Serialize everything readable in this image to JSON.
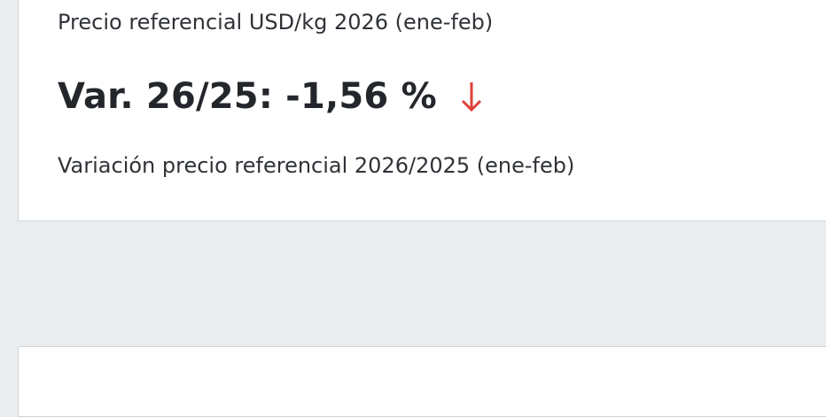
{
  "price_card": {
    "caption": "Precio referencial USD/kg 2026 (ene-feb)",
    "variation_value": "Var. 26/25: -1,56 %",
    "trend_icon": "arrow-down-icon",
    "trend_color": "#e0413a",
    "variation_caption": "Variación precio referencial 2026/2025 (ene-feb)"
  },
  "colors": {
    "page_background": "#e9edf0",
    "card_background": "#ffffff",
    "card_border": "#cfd4d8"
  }
}
